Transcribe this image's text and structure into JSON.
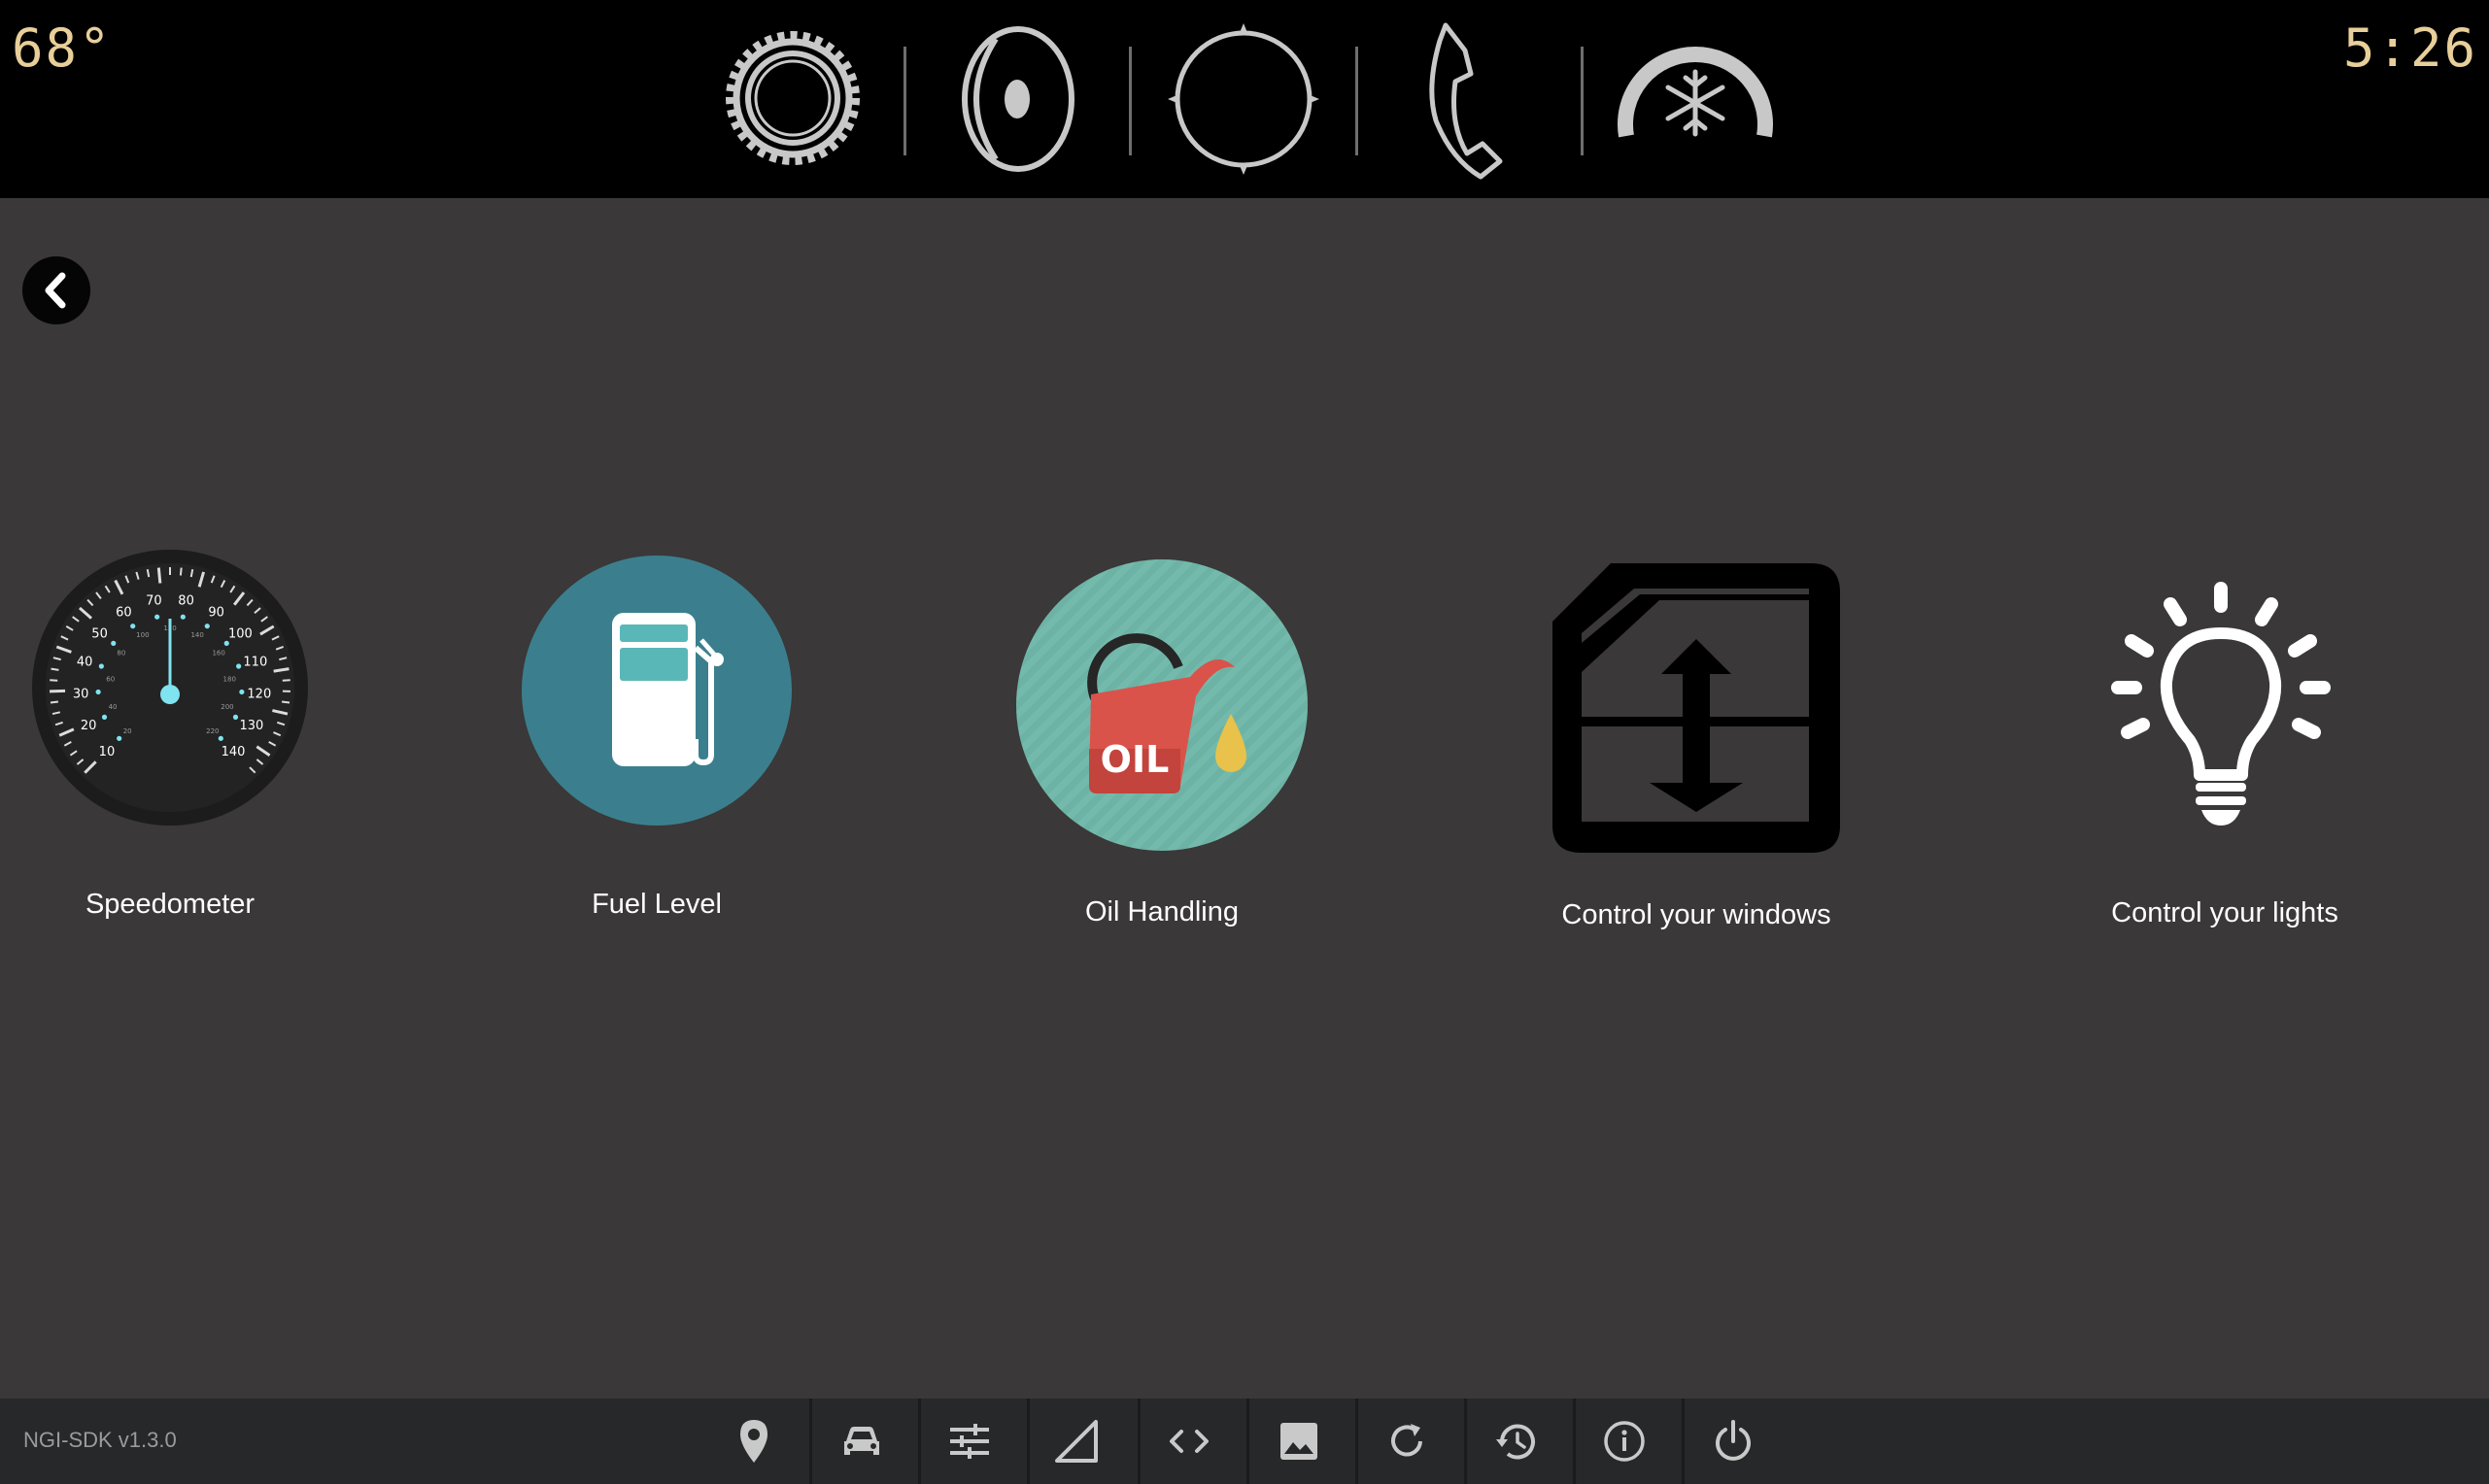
{
  "topbar": {
    "temperature": "68°",
    "time": "5:26",
    "icons": [
      "settings-gear-icon",
      "speaker-icon",
      "navigation-crosshair-icon",
      "phone-icon",
      "climate-fan-icon"
    ],
    "icon_color": "#c8c8c8",
    "text_color": "#e8cf9a"
  },
  "main": {
    "back_icon": "chevron-left-icon",
    "tiles": [
      {
        "label": "Speedometer",
        "icon": "speedometer-icon"
      },
      {
        "label": "Fuel Level",
        "icon": "fuel-pump-icon"
      },
      {
        "label": "Oil Handling",
        "icon": "oil-can-icon"
      },
      {
        "label": "Control your windows",
        "icon": "window-control-icon"
      },
      {
        "label": "Control your lights",
        "icon": "light-bulb-icon"
      }
    ],
    "speedometer": {
      "major_ticks": [
        "10",
        "20",
        "30",
        "40",
        "50",
        "60",
        "70",
        "80",
        "90",
        "100",
        "110",
        "120",
        "130",
        "140"
      ],
      "minor_ticks": [
        "20",
        "40",
        "60",
        "80",
        "100",
        "120",
        "140",
        "160",
        "180",
        "200",
        "220"
      ],
      "needle_color": "#7fe3f0"
    },
    "oil_label": "OIL",
    "colors": {
      "background": "#3a3838",
      "fuel_circle": "#3b7f8e",
      "oil_circle": "#6db3a5",
      "oil_can": "#d9534a",
      "oil_drop": "#e8c24a"
    }
  },
  "bottombar": {
    "version": "NGI-SDK v1.3.0",
    "buttons": [
      "location-pin-icon",
      "car-icon",
      "sliders-icon",
      "signal-icon",
      "code-icon",
      "image-icon",
      "refresh-icon",
      "history-icon",
      "info-icon",
      "power-icon"
    ]
  }
}
